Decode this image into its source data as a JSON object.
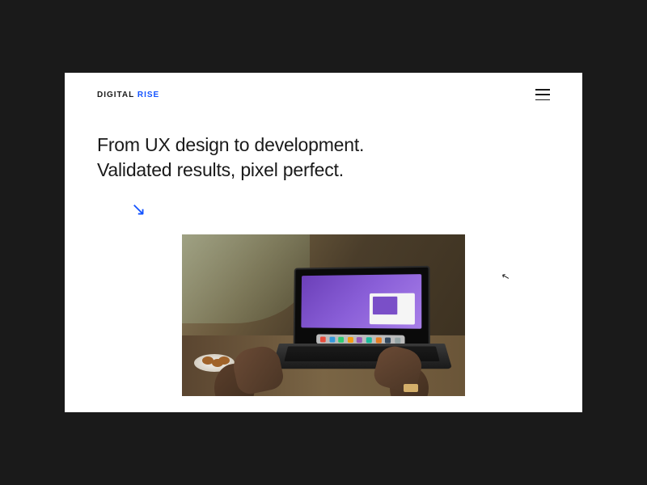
{
  "logo": {
    "text_dark": "DIGITAL",
    "text_accent": "RISE"
  },
  "hero": {
    "line1": "From UX design to development.",
    "line2": "Validated results, pixel perfect."
  },
  "arrow_glyph": "↘",
  "colors": {
    "accent": "#1353ff",
    "background": "#1a1a1a",
    "page": "#ffffff"
  }
}
